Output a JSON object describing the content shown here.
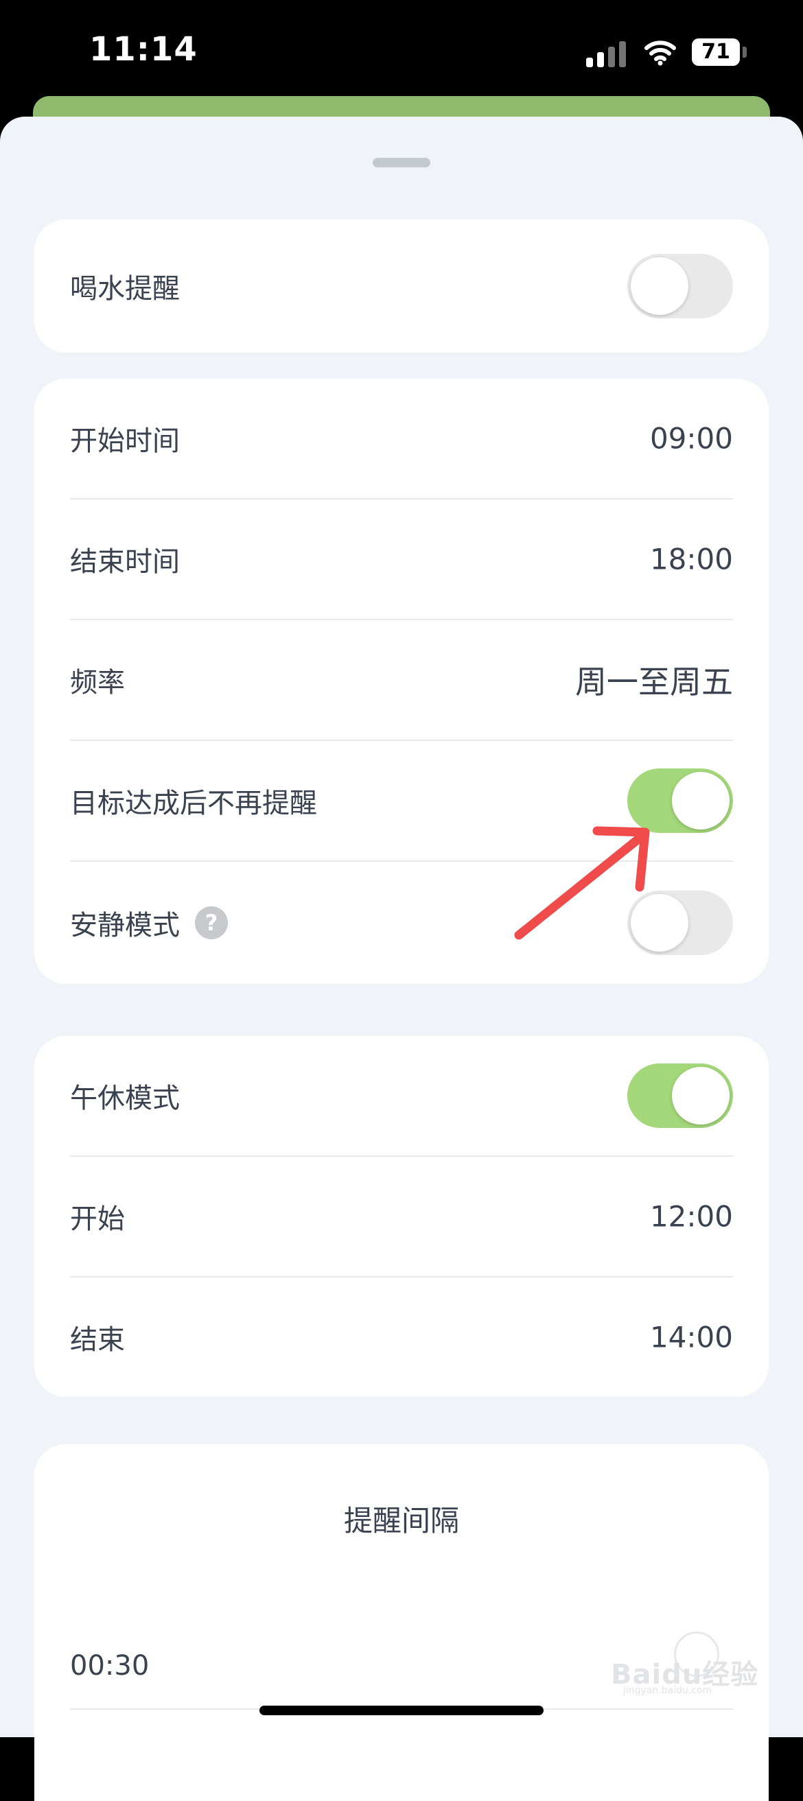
{
  "status_bar": {
    "time": "11:14",
    "battery": "71",
    "icons": [
      "signal-icon",
      "wifi-icon",
      "battery-icon"
    ]
  },
  "colors": {
    "toggle_on": "#a3d77a",
    "toggle_off": "#e9e9ea",
    "sheet_bg": "#f0f4f9",
    "annotation_arrow": "#ef4b4b"
  },
  "drink_reminder": {
    "label": "喝水提醒",
    "enabled": false
  },
  "schedule": {
    "start_label": "开始时间",
    "start_value": "09:00",
    "end_label": "结束时间",
    "end_value": "18:00",
    "frequency_label": "频率",
    "frequency_value": "周一至周五",
    "stop_after_goal_label": "目标达成后不再提醒",
    "stop_after_goal_enabled": true,
    "quiet_mode_label": "安静模式",
    "quiet_mode_help": "?",
    "quiet_mode_enabled": false
  },
  "nap": {
    "label": "午休模式",
    "enabled": true,
    "start_label": "开始",
    "start_value": "12:00",
    "end_label": "结束",
    "end_value": "14:00"
  },
  "interval": {
    "title": "提醒间隔",
    "value": "00:30"
  },
  "watermark": {
    "text": "Baidu经验",
    "sub": "jingyan.baidu.com"
  }
}
